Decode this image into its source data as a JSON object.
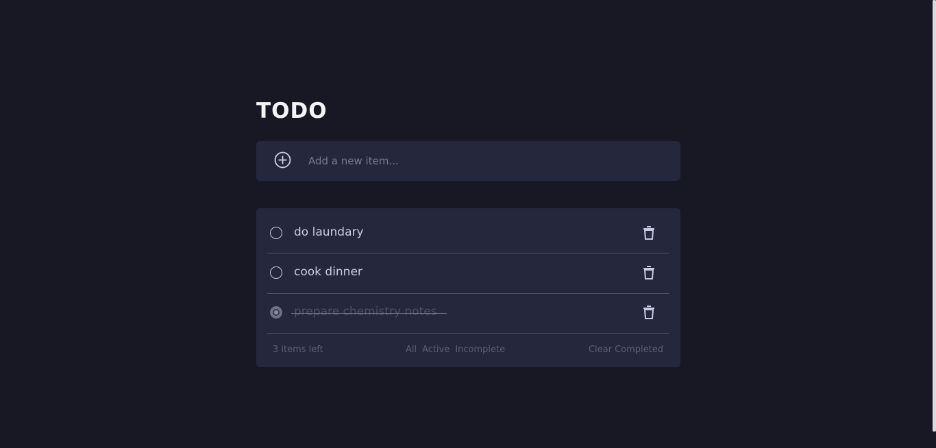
{
  "app": {
    "title": "TODO"
  },
  "new_item": {
    "placeholder": "Add a new item...",
    "value": "",
    "icon": "plus-circle-icon"
  },
  "todos": [
    {
      "text": "do laundary",
      "completed": false
    },
    {
      "text": "cook dinner",
      "completed": false
    },
    {
      "text": "prepare chemistry notes",
      "completed": true
    }
  ],
  "footer": {
    "items_left": "3 items left",
    "filters": [
      "All",
      "Active",
      "Incomplete"
    ],
    "clear_label": "Clear Completed"
  },
  "colors": {
    "background": "#181824",
    "card": "#25273c",
    "text": "#c8cbe7",
    "muted": "#5b5e7e",
    "title": "#f4f4f7",
    "divider": "#4d5067"
  }
}
